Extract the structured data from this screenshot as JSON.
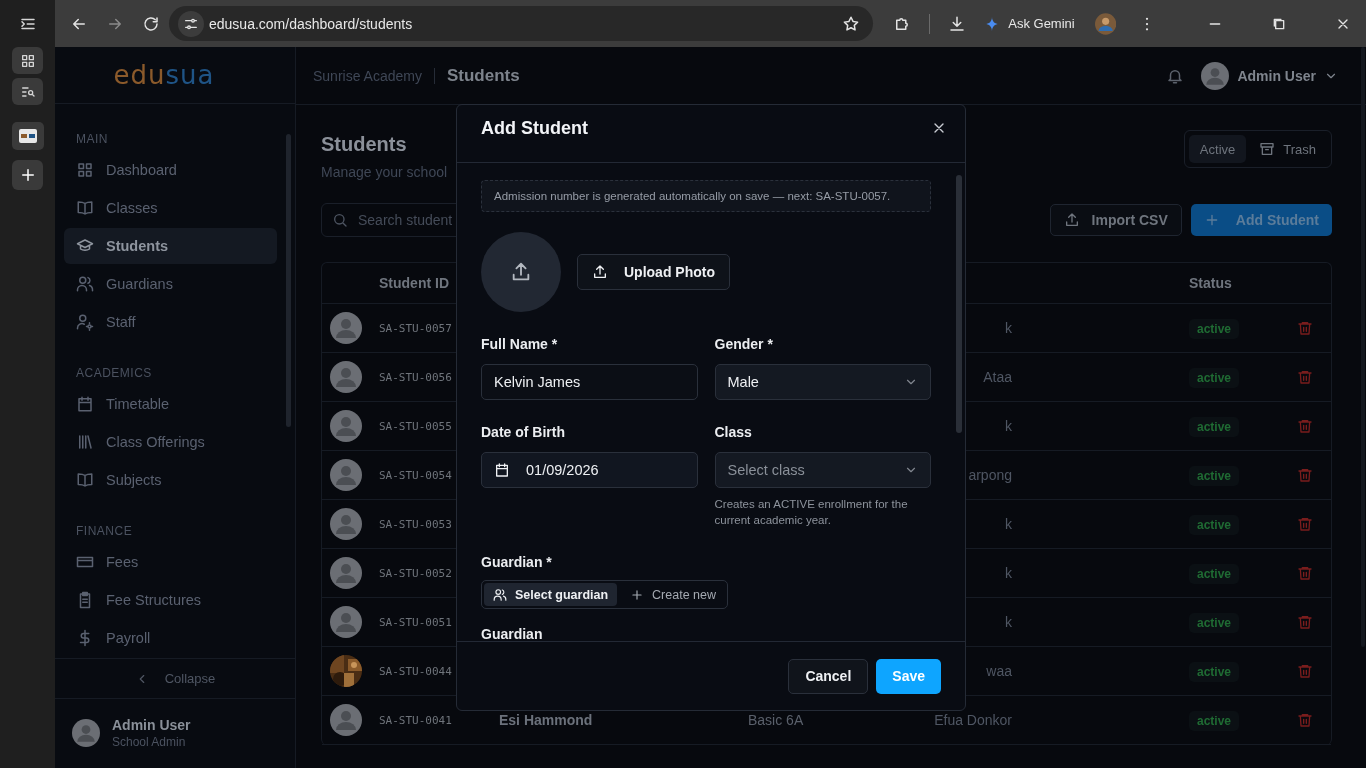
{
  "browser": {
    "url": "edusua.com/dashboard/students",
    "gemini_label": "Ask Gemini"
  },
  "logo": [
    {
      "text": "edu",
      "color": "#8b5a2b"
    },
    {
      "text": "sua",
      "color": "#1f5486"
    }
  ],
  "sidebar": {
    "sections": [
      {
        "title": "MAIN",
        "items": [
          {
            "label": "Dashboard",
            "selected": false
          },
          {
            "label": "Classes",
            "selected": false
          },
          {
            "label": "Students",
            "selected": true
          },
          {
            "label": "Guardians",
            "selected": false
          },
          {
            "label": "Staff",
            "selected": false
          }
        ]
      },
      {
        "title": "ACADEMICS",
        "items": [
          {
            "label": "Timetable",
            "selected": false
          },
          {
            "label": "Class Offerings",
            "selected": false
          },
          {
            "label": "Subjects",
            "selected": false
          }
        ]
      },
      {
        "title": "FINANCE",
        "items": [
          {
            "label": "Fees",
            "selected": false
          },
          {
            "label": "Fee Structures",
            "selected": false
          },
          {
            "label": "Payroll",
            "selected": false
          }
        ]
      }
    ],
    "collapse": "Collapse",
    "user": {
      "name": "Admin User",
      "role": "School Admin"
    }
  },
  "header": {
    "school": "Sunrise Academy",
    "page": "Students",
    "user": "Admin User"
  },
  "page": {
    "title": "Students",
    "subtitle": "Manage your school",
    "view_toggle": [
      {
        "label": "Active",
        "selected": true
      },
      {
        "label": "Trash",
        "selected": false
      }
    ],
    "search": {
      "placeholder": "Search student"
    },
    "import_button": "Import CSV",
    "add_button": "Add Student"
  },
  "table": {
    "columns": {
      "id": "Student ID",
      "status": "Status"
    },
    "rows": [
      {
        "kind": "default",
        "id": "SA-STU-0057",
        "guardian": "k",
        "status": "active"
      },
      {
        "kind": "default",
        "id": "SA-STU-0056",
        "guardian": "Ataa",
        "status": "active"
      },
      {
        "kind": "default",
        "id": "SA-STU-0055",
        "guardian": "k",
        "status": "active"
      },
      {
        "kind": "default",
        "id": "SA-STU-0054",
        "guardian": "arpong",
        "status": "active"
      },
      {
        "kind": "default",
        "id": "SA-STU-0053",
        "guardian": "k",
        "status": "active"
      },
      {
        "kind": "default",
        "id": "SA-STU-0052",
        "guardian": "k",
        "status": "active"
      },
      {
        "kind": "default",
        "id": "SA-STU-0051",
        "guardian": "k",
        "status": "active"
      },
      {
        "id": "SA-STU-0044",
        "guardian": "waa",
        "status": "active"
      },
      {
        "kind": "default",
        "id": "SA-STU-0041",
        "name": "Esi Hammond",
        "class": "Basic 6A",
        "guardian": "Efua Donkor",
        "status": "active"
      }
    ]
  },
  "modal": {
    "title": "Add Student",
    "note": "Admission number is generated automatically on save — next: SA-STU-0057.",
    "upload": "Upload Photo",
    "fields": [
      {
        "label": "Full Name *",
        "kind": "text",
        "value": "Kelvin James"
      },
      {
        "label": "Gender *",
        "kind": "select",
        "value": "Male"
      },
      {
        "label": "Date of Birth",
        "kind": "date",
        "value": "01/09/2026"
      },
      {
        "label": "Class",
        "kind": "select",
        "placeholder": "Select class",
        "help": "Creates an ACTIVE enrollment for the current academic year."
      }
    ],
    "guardian": {
      "label": "Guardian *",
      "modes": [
        {
          "label": "Select guardian",
          "selected": true
        },
        {
          "label": "Create new",
          "selected": false
        }
      ]
    },
    "next_label": "Guardian",
    "cancel": "Cancel",
    "save": "Save"
  }
}
